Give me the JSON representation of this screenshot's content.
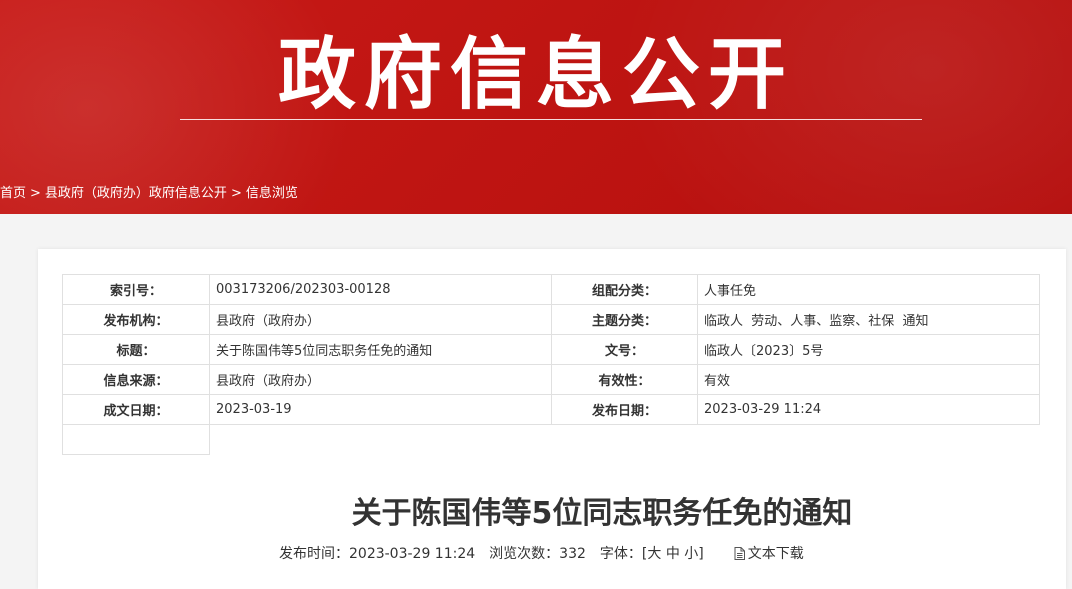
{
  "banner": {
    "title": "政府信息公开"
  },
  "breadcrumb": {
    "items": [
      "首页",
      "县政府（政府办）政府信息公开",
      "信息浏览"
    ],
    "separator": ">"
  },
  "meta": {
    "rows": [
      {
        "l1": "索引号：",
        "v1": "003173206/202303-00128",
        "l2": "组配分类：",
        "v2": "人事任免"
      },
      {
        "l1": "发布机构：",
        "v1": "县政府（政府办）",
        "l2": "主题分类：",
        "v2": "临政人  劳动、人事、监察、社保  通知"
      },
      {
        "l1": "标题：",
        "v1": "关于陈国伟等5位同志职务任免的通知",
        "l2": "文号：",
        "v2": "临政人〔2023〕5号"
      },
      {
        "l1": "信息来源：",
        "v1": "县政府（政府办）",
        "l2": "有效性：",
        "v2": "有效"
      },
      {
        "l1": "成文日期：",
        "v1": "2023-03-19",
        "l2": "发布日期：",
        "v2": "2023-03-29 11:24"
      }
    ]
  },
  "article": {
    "title": "关于陈国伟等5位同志职务任免的通知",
    "publish_label": "发布时间：",
    "publish_time": "2023-03-29 11:24",
    "views_label": "浏览次数：",
    "views": "332",
    "font_label": "字体：",
    "font_open": "[",
    "font_large": "大",
    "font_medium": "中",
    "font_small": "小",
    "font_close": "]",
    "download_label": "文本下载",
    "download_icon": "document-icon"
  },
  "colors": {
    "banner_red": "#c81a17"
  }
}
